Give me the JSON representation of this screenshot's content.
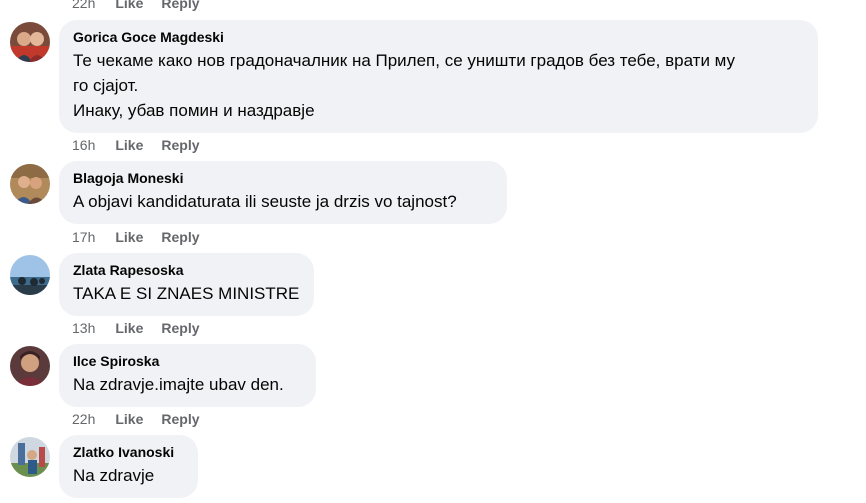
{
  "top_actions": {
    "time": "22h",
    "like": "Like",
    "reply": "Reply"
  },
  "comments": [
    {
      "author": "Gorica Goce Magdeski",
      "lines": [
        "Те чекаме како нов градоначалник на Прилеп, се уништи градов без тебе, врати му",
        "го сјајот.",
        "Инаку, убав помин и наздравје"
      ],
      "time": "16h",
      "like": "Like",
      "reply": "Reply"
    },
    {
      "author": "Blagoja Moneski",
      "lines": [
        "A objavi kandidaturata ili seuste ja drzis vo tajnost?"
      ],
      "time": "17h",
      "like": "Like",
      "reply": "Reply"
    },
    {
      "author": "Zlata Rapesoska",
      "lines": [
        "TAKA E SI ZNAES MINISTRE"
      ],
      "time": "13h",
      "like": "Like",
      "reply": "Reply"
    },
    {
      "author": "Ilce Spiroska",
      "lines": [
        "Na zdravje.imajte ubav den."
      ],
      "time": "22h",
      "like": "Like",
      "reply": "Reply"
    },
    {
      "author": "Zlatko Ivanoski",
      "lines": [
        "Na zdravje"
      ]
    }
  ]
}
